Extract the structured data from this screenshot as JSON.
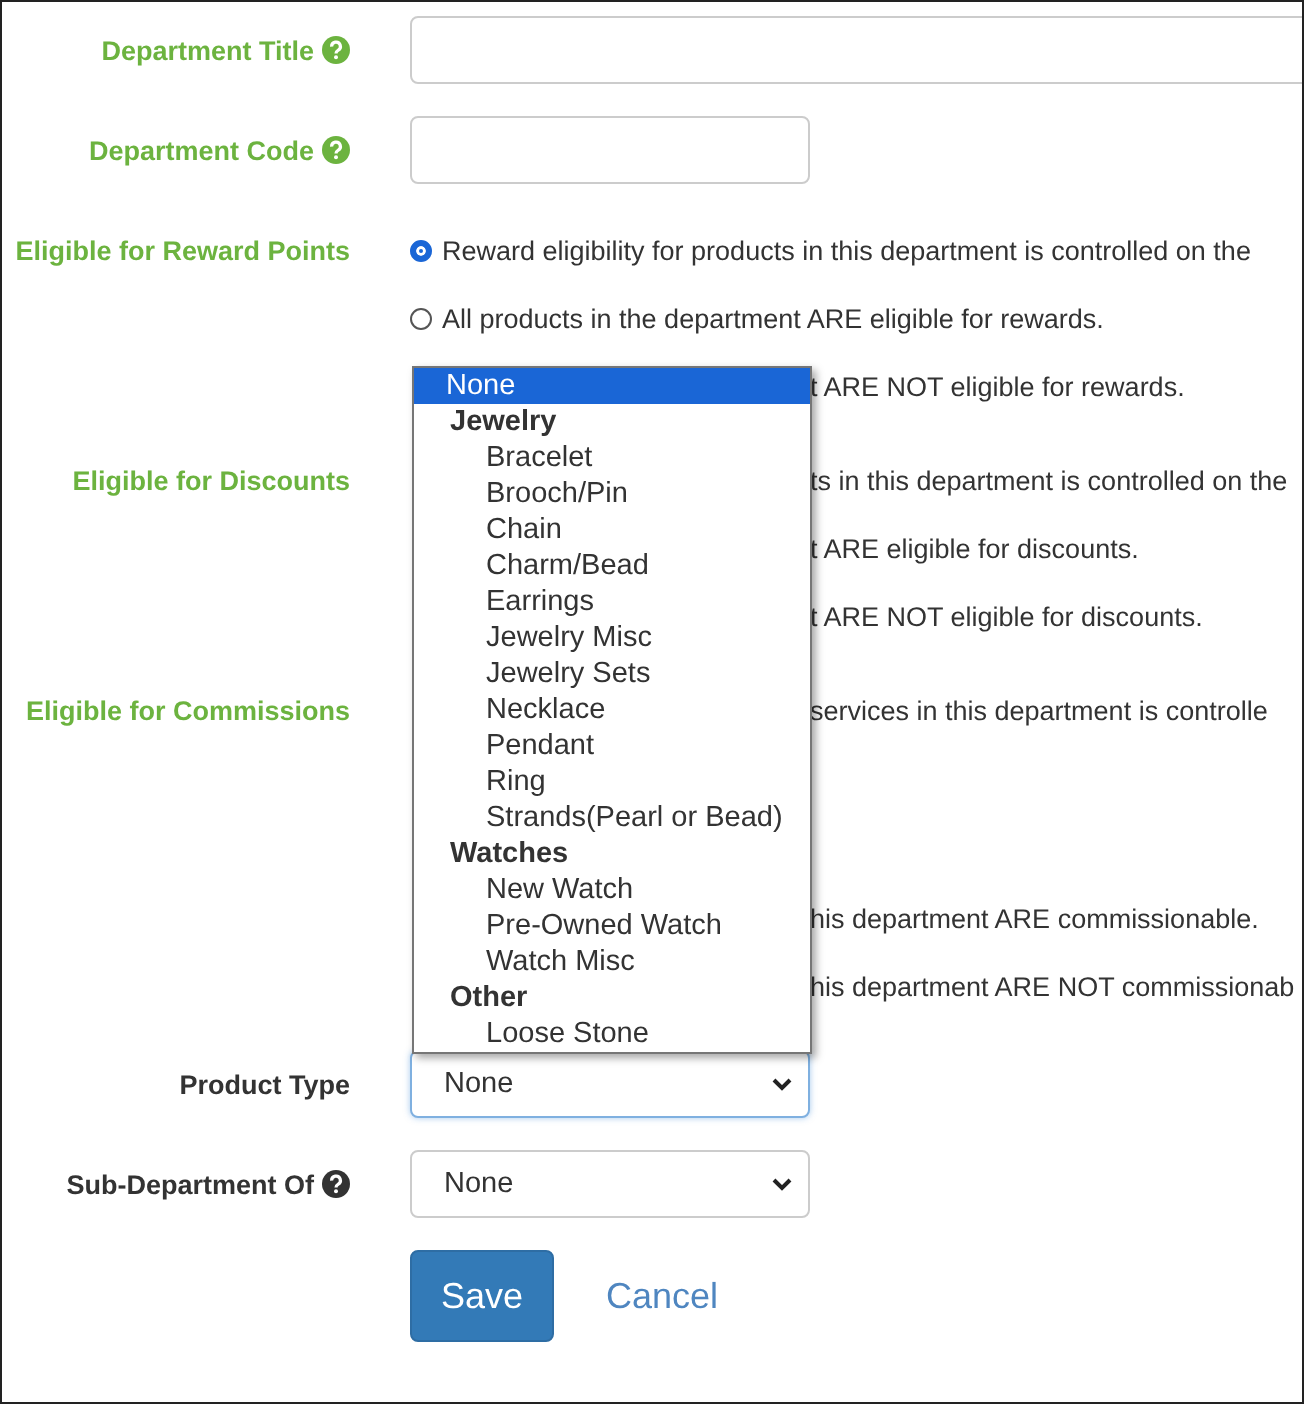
{
  "fields": [
    {
      "kind": "text",
      "label": "Department Title",
      "color": "#6cb33f",
      "help": true,
      "wide": true
    },
    {
      "kind": "text",
      "label": "Department Code",
      "color": "#6cb33f",
      "help": true,
      "wide": false
    },
    {
      "kind": "radio",
      "label": "Eligible for Reward Points",
      "color": "#6cb33f",
      "help": false,
      "options": [
        {
          "text": "Reward eligibility for products in this department is controlled on the",
          "selected": true
        },
        {
          "text": "All products in the department ARE eligible for rewards.",
          "selected": false
        },
        {
          "text": "t ARE NOT eligible for rewards."
        }
      ]
    },
    {
      "kind": "radio",
      "label": "Eligible for Discounts",
      "color": "#6cb33f",
      "help": false,
      "options": [
        {
          "text": "ts in this department is controlled on the"
        },
        {
          "text": "t ARE eligible for discounts."
        },
        {
          "text": "t ARE NOT eligible for discounts."
        }
      ]
    },
    {
      "kind": "radio",
      "label": "Eligible for Commissions",
      "color": "#6cb33f",
      "help": false,
      "options": [
        {
          "text": "services in this department is controlle"
        },
        {
          "text": "his department ARE commissionable."
        },
        {
          "text": "his department ARE NOT commissionab"
        }
      ]
    },
    {
      "kind": "select",
      "label": "Product Type",
      "color": "#333333",
      "help": false,
      "value": "None",
      "focused": true
    },
    {
      "kind": "select",
      "label": "Sub-Department Of",
      "color": "#333333",
      "help": true,
      "value": "None",
      "focused": false
    }
  ],
  "dropdown": {
    "options": [
      {
        "kind": "option",
        "text": "None",
        "selected": true
      },
      {
        "kind": "group",
        "text": "Jewelry"
      },
      {
        "kind": "option",
        "text": "Bracelet",
        "selected": false
      },
      {
        "kind": "option",
        "text": "Brooch/Pin",
        "selected": false
      },
      {
        "kind": "option",
        "text": "Chain",
        "selected": false
      },
      {
        "kind": "option",
        "text": "Charm/Bead",
        "selected": false
      },
      {
        "kind": "option",
        "text": "Earrings",
        "selected": false
      },
      {
        "kind": "option",
        "text": "Jewelry Misc",
        "selected": false
      },
      {
        "kind": "option",
        "text": "Jewelry Sets",
        "selected": false
      },
      {
        "kind": "option",
        "text": "Necklace",
        "selected": false
      },
      {
        "kind": "option",
        "text": "Pendant",
        "selected": false
      },
      {
        "kind": "option",
        "text": "Ring",
        "selected": false
      },
      {
        "kind": "option",
        "text": "Strands(Pearl or Bead)",
        "selected": false
      },
      {
        "kind": "group",
        "text": "Watches"
      },
      {
        "kind": "option",
        "text": "New Watch",
        "selected": false
      },
      {
        "kind": "option",
        "text": "Pre-Owned Watch",
        "selected": false
      },
      {
        "kind": "option",
        "text": "Watch Misc",
        "selected": false
      },
      {
        "kind": "group",
        "text": "Other"
      },
      {
        "kind": "option",
        "text": "Loose Stone",
        "selected": false
      }
    ]
  },
  "actions": {
    "save": "Save",
    "cancel": "Cancel"
  }
}
